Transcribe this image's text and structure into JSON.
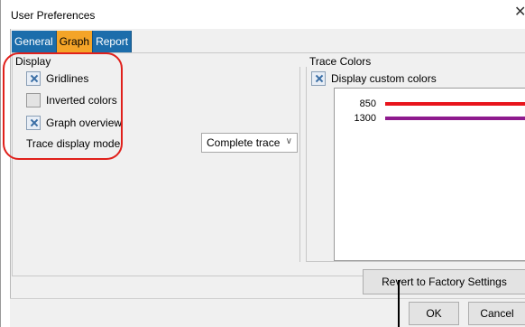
{
  "window": {
    "title": "User Preferences",
    "close_glyph": "✕"
  },
  "tabs": [
    {
      "label": "General"
    },
    {
      "label": "Graph",
      "active": true
    },
    {
      "label": "Report"
    }
  ],
  "display": {
    "group_label": "Display",
    "gridlines": {
      "label": "Gridlines",
      "checked": true
    },
    "inverted": {
      "label": "Inverted colors",
      "checked": false
    },
    "overview": {
      "label": "Graph overview",
      "checked": true
    },
    "trace_mode_label": "Trace display mode:",
    "trace_mode_value": "Complete trace"
  },
  "trace_colors": {
    "group_label": "Trace Colors",
    "custom": {
      "label": "Display custom colors",
      "checked": true
    },
    "items": [
      {
        "name": "850",
        "color": "#e8141c"
      },
      {
        "name": "1300",
        "color": "#8e1a8e"
      }
    ]
  },
  "buttons": {
    "revert": "Revert to Factory Settings",
    "ok": "OK",
    "cancel": "Cancel"
  },
  "colors": {
    "tab_bg": "#1c6dab",
    "tab_active_bg": "#f4a428",
    "highlight": "#e0201b"
  }
}
